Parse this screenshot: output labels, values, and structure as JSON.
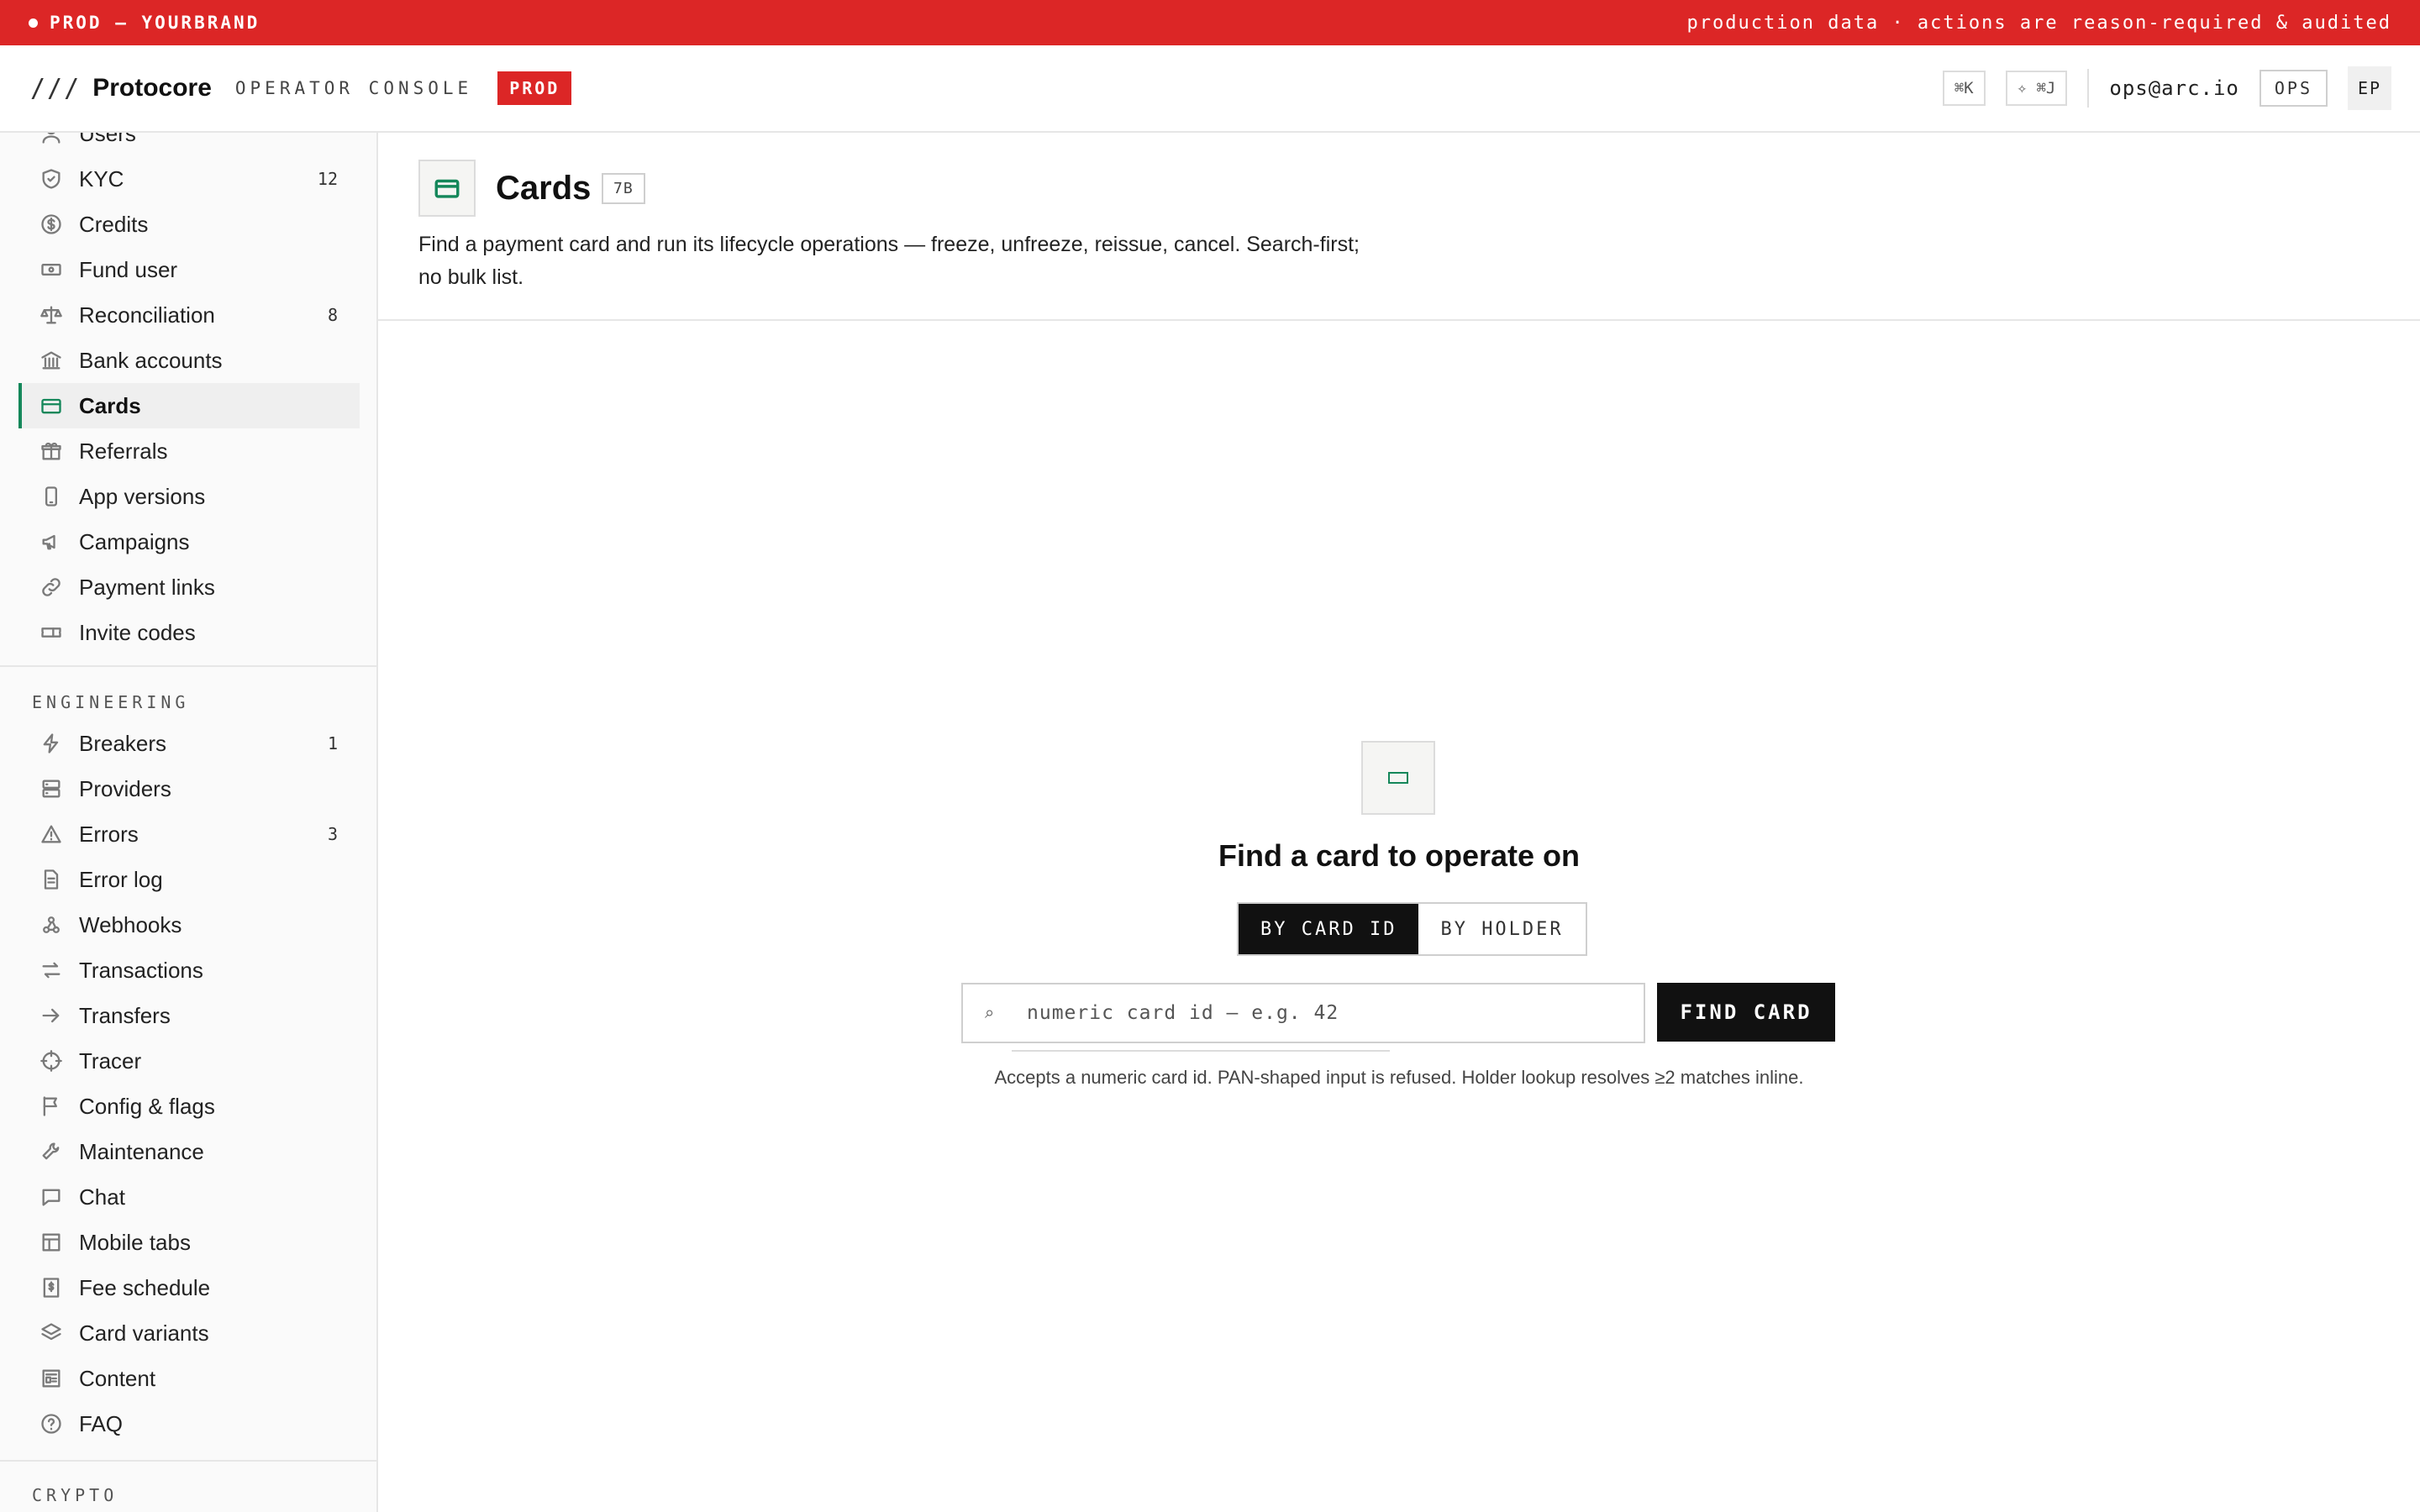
{
  "banner": {
    "left": "PROD — YOURBRAND",
    "right": "production data · actions are reason-required & audited"
  },
  "header": {
    "slashes": "///",
    "brand": "Protocore",
    "console": "OPERATOR CONSOLE",
    "env": "PROD",
    "shortcut_search": "⌘K",
    "shortcut_jump": "✧ ⌘J",
    "email": "ops@arc.io",
    "role": "OPS",
    "avatar": "EP"
  },
  "sidebar": {
    "top_items": [
      {
        "label": "Users",
        "icon": "user-icon",
        "count": ""
      },
      {
        "label": "KYC",
        "icon": "shield-icon",
        "count": "12"
      },
      {
        "label": "Credits",
        "icon": "dollar-circle-icon",
        "count": ""
      },
      {
        "label": "Fund user",
        "icon": "banknote-icon",
        "count": ""
      },
      {
        "label": "Reconciliation",
        "icon": "scale-icon",
        "count": "8"
      },
      {
        "label": "Bank accounts",
        "icon": "bank-icon",
        "count": ""
      },
      {
        "label": "Cards",
        "icon": "credit-card-icon",
        "count": "",
        "active": true
      },
      {
        "label": "Referrals",
        "icon": "gift-icon",
        "count": ""
      },
      {
        "label": "App versions",
        "icon": "smartphone-icon",
        "count": ""
      },
      {
        "label": "Campaigns",
        "icon": "megaphone-icon",
        "count": ""
      },
      {
        "label": "Payment links",
        "icon": "link-icon",
        "count": ""
      },
      {
        "label": "Invite codes",
        "icon": "ticket-icon",
        "count": ""
      }
    ],
    "engineering_title": "ENGINEERING",
    "engineering_items": [
      {
        "label": "Breakers",
        "icon": "zap-icon",
        "count": "1"
      },
      {
        "label": "Providers",
        "icon": "server-icon",
        "count": ""
      },
      {
        "label": "Errors",
        "icon": "alert-triangle-icon",
        "count": "3"
      },
      {
        "label": "Error log",
        "icon": "file-text-icon",
        "count": ""
      },
      {
        "label": "Webhooks",
        "icon": "webhook-icon",
        "count": ""
      },
      {
        "label": "Transactions",
        "icon": "arrows-swap-icon",
        "count": ""
      },
      {
        "label": "Transfers",
        "icon": "arrow-right-icon",
        "count": ""
      },
      {
        "label": "Tracer",
        "icon": "crosshair-icon",
        "count": ""
      },
      {
        "label": "Config & flags",
        "icon": "flag-icon",
        "count": ""
      },
      {
        "label": "Maintenance",
        "icon": "wrench-icon",
        "count": ""
      },
      {
        "label": "Chat",
        "icon": "message-square-icon",
        "count": ""
      },
      {
        "label": "Mobile tabs",
        "icon": "layout-icon",
        "count": ""
      },
      {
        "label": "Fee schedule",
        "icon": "receipt-dollar-icon",
        "count": ""
      },
      {
        "label": "Card variants",
        "icon": "layers-icon",
        "count": ""
      },
      {
        "label": "Content",
        "icon": "newspaper-icon",
        "count": ""
      },
      {
        "label": "FAQ",
        "icon": "help-circle-icon",
        "count": ""
      }
    ],
    "crypto_title": "CRYPTO"
  },
  "page": {
    "title": "Cards",
    "code": "7B",
    "description": "Find a payment card and run its lifecycle operations — freeze, unfreeze, reissue, cancel. Search-first; no bulk list."
  },
  "finder": {
    "title": "Find a card to operate on",
    "mode_options": [
      "BY CARD ID",
      "BY HOLDER"
    ],
    "selected_mode": "BY CARD ID",
    "search_icon": "⌕",
    "input_placeholder": "numeric card id — e.g. 42",
    "input_value": "",
    "button_label": "FIND CARD",
    "hint": "Accepts a numeric card id. PAN-shaped input is refused. Holder lookup resolves ≥2 matches inline."
  },
  "colors": {
    "prod_red": "#dc2626",
    "accent_green": "#14875a",
    "primary_black": "#111111"
  }
}
